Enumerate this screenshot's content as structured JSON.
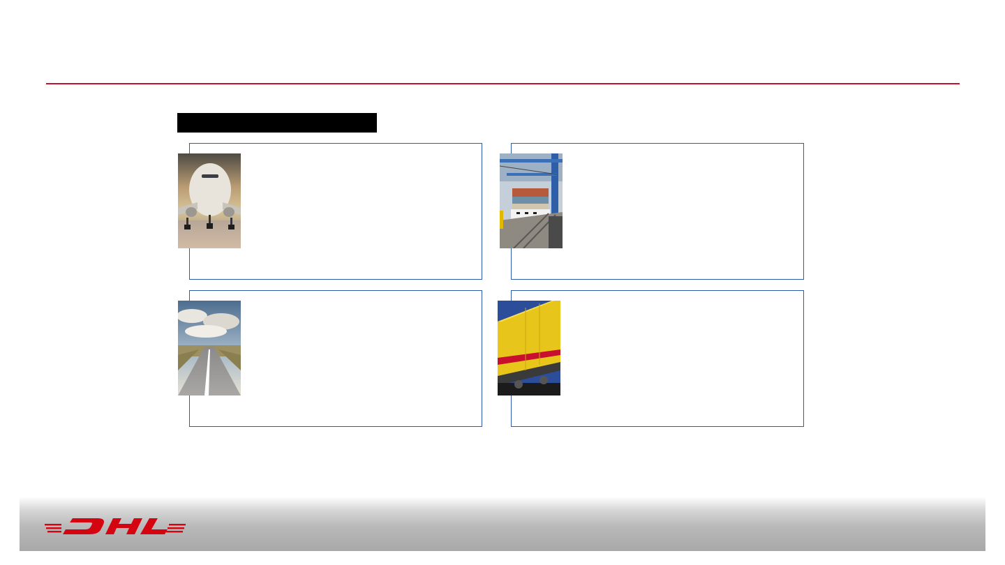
{
  "slide": {
    "heading_bar_text": "",
    "accent_color": "#c8102e",
    "card_border_color": "#2e5aa8"
  },
  "cards": [
    {
      "name": "air",
      "image": "airplane-photo",
      "text": ""
    },
    {
      "name": "ocean",
      "image": "container-ship-photo",
      "text": ""
    },
    {
      "name": "road",
      "image": "road-photo",
      "text": ""
    },
    {
      "name": "rail",
      "image": "freight-train-photo",
      "text": ""
    }
  ],
  "footer": {
    "logo": "DHL"
  }
}
